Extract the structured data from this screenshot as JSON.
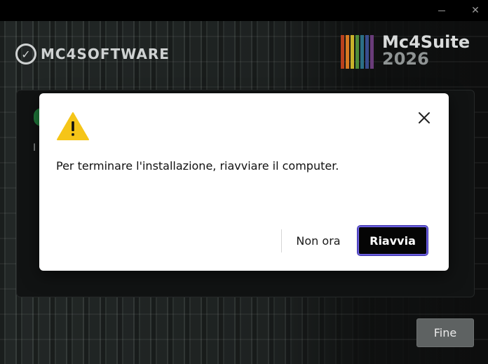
{
  "window": {
    "minimize_glyph": "—",
    "close_glyph": "✕"
  },
  "background": {
    "brand_name": "MC4SOFTWARE",
    "suite_name": "Mc4Suite",
    "suite_year": "2026",
    "stripe_colors": [
      "#b9411e",
      "#d77a22",
      "#c9b22a",
      "#4f8b3a",
      "#2c6f86",
      "#394d8e",
      "#6a3c7a"
    ],
    "panel_letter": "I",
    "finish_label": "Fine"
  },
  "dialog": {
    "icon": "warning-icon",
    "message": "Per terminare l'installazione, riavviare il computer.",
    "later_label": "Non ora",
    "restart_label": "Riavvia",
    "accent_color": "#6b5fe0",
    "warning_color": "#f5c518"
  }
}
